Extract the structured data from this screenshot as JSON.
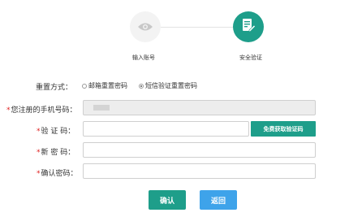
{
  "steps": [
    {
      "label": "输入账号",
      "icon": "eye-icon",
      "state": "done"
    },
    {
      "label": "安全验证",
      "icon": "document-edit-icon",
      "state": "active"
    }
  ],
  "form": {
    "reset_method": {
      "label": "重置方式：",
      "options": [
        {
          "label": "邮箱重置密码",
          "selected": false
        },
        {
          "label": "短信验证重置密码",
          "selected": true
        }
      ]
    },
    "phone": {
      "required_mark": "*",
      "label": "您注册的手机号码：",
      "value": ""
    },
    "code": {
      "required_mark": "*",
      "label": "验 证 码：",
      "value": "",
      "button": "免费获取验证码"
    },
    "new_password": {
      "required_mark": "*",
      "label": "新 密 码：",
      "value": ""
    },
    "confirm_password": {
      "required_mark": "*",
      "label": "确认密码：",
      "value": ""
    }
  },
  "buttons": {
    "confirm": "确认",
    "back": "返回"
  },
  "colors": {
    "primary": "#1e9e8a",
    "secondary": "#3ea3ea",
    "required": "#e02020"
  }
}
